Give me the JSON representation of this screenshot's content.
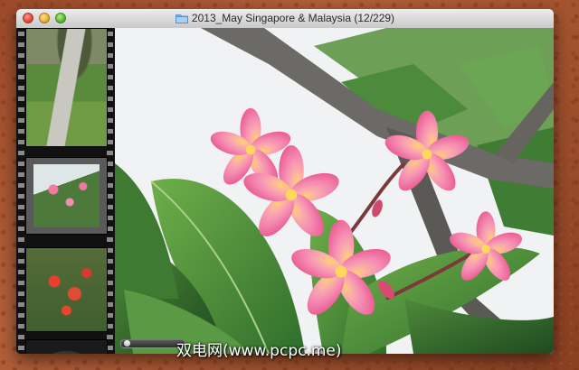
{
  "window": {
    "title": "2013_May Singapore & Malaysia (12/229)"
  },
  "filmstrip": {
    "thumbnails": [
      {
        "subject": "garden path"
      },
      {
        "subject": "pink frangipani",
        "selected": true
      },
      {
        "subject": "red flowers"
      },
      {
        "subject": "stone arch"
      }
    ]
  },
  "viewer": {
    "photo": "pink frangipani flowers on branches"
  },
  "watermark": "双电网(www.pcpc.me)"
}
